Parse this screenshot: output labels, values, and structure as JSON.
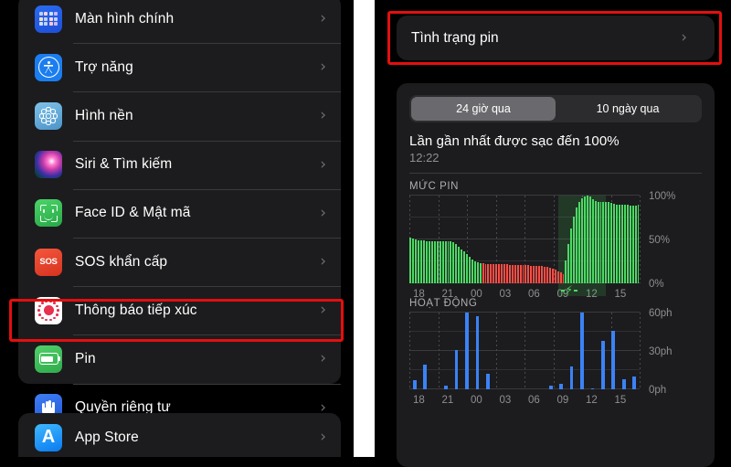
{
  "settings": {
    "rows": [
      {
        "label": "Màn hình chính",
        "icon": "home-screen-icon"
      },
      {
        "label": "Trợ năng",
        "icon": "accessibility-icon"
      },
      {
        "label": "Hình nền",
        "icon": "wallpaper-icon"
      },
      {
        "label": "Siri & Tìm kiếm",
        "icon": "siri-icon"
      },
      {
        "label": "Face ID & Mật mã",
        "icon": "face-id-icon"
      },
      {
        "label": "SOS khẩn cấp",
        "icon": "sos-icon"
      },
      {
        "label": "Thông báo tiếp xúc",
        "icon": "exposure-notification-icon"
      },
      {
        "label": "Pin",
        "icon": "battery-icon"
      },
      {
        "label": "Quyền riêng tư",
        "icon": "privacy-hand-icon"
      }
    ],
    "rows_second": [
      {
        "label": "App Store",
        "icon": "app-store-icon"
      }
    ],
    "sos_text": "SOS",
    "appstore_glyph": "A",
    "chevron": "›",
    "highlight_color": "#e40f0f"
  },
  "battery_screen": {
    "health_row_label": "Tình trạng pin",
    "segments": [
      {
        "label": "24 giờ qua",
        "active": true
      },
      {
        "label": "10 ngày qua",
        "active": false
      }
    ],
    "last_charge_label": "Lần gần nhất được sạc đến 100%",
    "last_charge_time": "12:22",
    "battery_section_title": "MỨC PIN",
    "activity_section_title": "HOẠT ĐỘNG",
    "charging_indicator": "⚡"
  },
  "chart_data": [
    {
      "type": "bar",
      "title": "MỨC PIN",
      "ylabel": "",
      "xlabel": "",
      "ylim": [
        0,
        100
      ],
      "yticks": [
        0,
        50,
        100
      ],
      "ytick_labels": [
        "0%",
        "50%",
        "100%"
      ],
      "xticks": [
        "18",
        "21",
        "00",
        "03",
        "06",
        "09",
        "12",
        "15"
      ],
      "grid": true,
      "legend": "none",
      "colors": {
        "discharging_green": "#4cd964",
        "low_red": "#ff4d45",
        "charging_band": "rgba(70,200,90,0.17)"
      },
      "annotation": "charging period marked with lightning bolt near 10:00–11:00",
      "values": [
        52,
        51,
        50,
        49,
        49,
        49,
        48,
        48,
        48,
        48,
        48,
        48,
        48,
        48,
        48,
        48,
        47,
        45,
        42,
        39,
        36,
        33,
        30,
        27,
        25,
        24,
        23,
        23,
        22,
        22,
        22,
        22,
        22,
        22,
        22,
        22,
        22,
        21,
        21,
        21,
        21,
        21,
        21,
        21,
        21,
        20,
        20,
        20,
        20,
        20,
        19,
        19,
        18,
        17,
        16,
        14,
        12,
        10,
        26,
        45,
        62,
        76,
        86,
        93,
        97,
        99,
        100,
        99,
        96,
        94,
        93,
        93,
        93,
        93,
        93,
        92,
        91,
        90,
        90,
        90,
        90,
        90,
        89,
        89,
        89,
        90
      ],
      "series_colors": [
        "green",
        "green",
        "green",
        "green",
        "green",
        "green",
        "green",
        "green",
        "green",
        "green",
        "green",
        "green",
        "green",
        "green",
        "green",
        "green",
        "green",
        "green",
        "green",
        "green",
        "green",
        "green",
        "green",
        "green",
        "green",
        "green",
        "green",
        "red",
        "red",
        "red",
        "red",
        "red",
        "red",
        "red",
        "red",
        "red",
        "red",
        "red",
        "red",
        "red",
        "red",
        "red",
        "red",
        "red",
        "red",
        "red",
        "red",
        "red",
        "red",
        "red",
        "red",
        "red",
        "red",
        "red",
        "red",
        "red",
        "red",
        "red",
        "green",
        "green",
        "green",
        "green",
        "green",
        "green",
        "green",
        "green",
        "green",
        "green",
        "green",
        "green",
        "green",
        "green",
        "green",
        "green",
        "green",
        "green",
        "green",
        "green",
        "green",
        "green",
        "green",
        "green",
        "green",
        "green",
        "green",
        "green"
      ]
    },
    {
      "type": "bar",
      "title": "HOẠT ĐỘNG",
      "ylabel": "",
      "xlabel": "",
      "ylim": [
        0,
        60
      ],
      "yticks": [
        0,
        30,
        60
      ],
      "ytick_labels": [
        "0ph",
        "30ph",
        "60ph"
      ],
      "xticks": [
        "18",
        "21",
        "00",
        "03",
        "06",
        "09",
        "12",
        "15"
      ],
      "grid": true,
      "legend": "none",
      "colors": {
        "bar": "#3b82f6"
      },
      "categories": [
        "18",
        "19",
        "20",
        "21",
        "22",
        "23",
        "00",
        "01",
        "02",
        "03",
        "04",
        "05",
        "06",
        "07",
        "08",
        "09",
        "10",
        "11",
        "12",
        "13",
        "14",
        "15"
      ],
      "values": [
        7,
        19,
        0,
        3,
        31,
        60,
        57,
        12,
        0,
        0,
        0,
        0,
        0,
        3,
        4,
        18,
        60,
        1,
        38,
        46,
        8,
        10
      ]
    }
  ]
}
